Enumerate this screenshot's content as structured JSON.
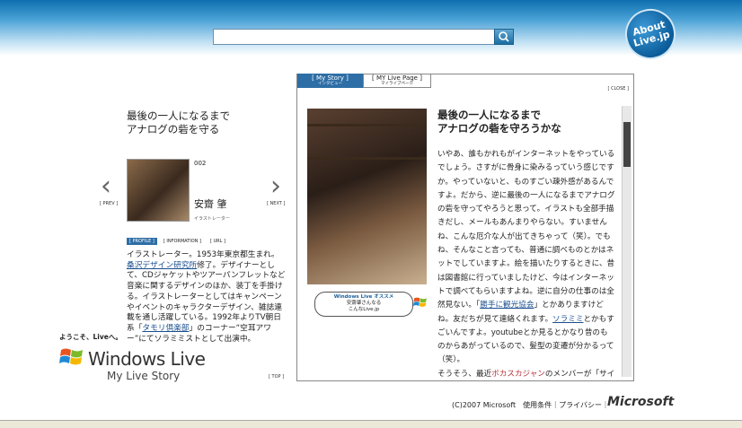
{
  "about_badge": [
    "About",
    "Live.jp"
  ],
  "left_title": [
    "最後の一人になるまで",
    "アナログの砦を守る"
  ],
  "person": {
    "number": "002",
    "name": "安齋 肇",
    "role": "イラストレーター"
  },
  "nav": {
    "prev": "[ PREV ]",
    "next": "[ NEXT ]"
  },
  "left_tabs": [
    "[ PROFILE ]",
    "[ INFORMATION ]",
    "[ URL ]"
  ],
  "bio": {
    "p1": "イラストレーター。1953年東京都生まれ。",
    "link1": "桑沢デザイン研究所",
    "p2": "修了。デザイナーとして、CDジャケットやツアーパンフレットなど音楽に関するデザインのほか、装丁を手掛ける。イラストレーターとしてはキャンペーンやイベントのキャラクターデザイン、雑誌連載を通し活躍している。1992年よりTV朝日系「",
    "link2": "タモリ倶楽部",
    "p3": "」のコーナー“空耳アワー”にてソラミミストとして出演中。"
  },
  "welcome": "ようこそ、Liveへ。",
  "logo": {
    "text": "Windows Live",
    "sub": "My Live Story"
  },
  "top_link": "[ TOP ]",
  "panel_tabs": [
    {
      "label": "[ My Story ]",
      "sub": "インタビュー"
    },
    {
      "label": "[ MY Live Page ]",
      "sub": "マイライブページ"
    }
  ],
  "close": "[ CLOSE ]",
  "bubble": {
    "line1": "Windows Live オススメ",
    "line2": "安齋肇さんなる",
    "line3": "こんなLive.jp"
  },
  "story_title": [
    "最後の一人になるまで",
    "アナログの砦を守ろうかな"
  ],
  "story": {
    "p1": "いやあ、誰もかれもがインターネットをやっているでしょう。さすがに骨身に染みるっていう感じですか。やっていないと、ものすごい疎外感があるんですよ。だから、逆に最後の一人になるまでアナログの砦を守ってやろうと思って。イラストも全部手描きだし、メールもあんまりやらない。すいませんね、こんな厄介な人が出てきちゃって（笑）。でもね、そんなこと言っても、普通に調べものとかはネットでしていますよ。絵を描いたりするときに、昔は図書館に行っていましたけど、今はインターネットで調べてもらいますよね。逆に自分の仕事のは全然見ない。「",
    "link1": "勝手に観光協会",
    "p2": "」とかありますけどね。友だちが見て連絡くれます。",
    "link2": "ソラミミ",
    "p3": "とかもすごいんですよ。youtubeとか見るとかなり昔のものからあがっているので、髪型の変遷が分かるって（笑）。",
    "p4": "そうそう、最近",
    "red": "ボカスカジャン",
    "p5": "のメンバーが「サイ"
  },
  "footer": "(C)2007 Microsoft　使用条件｜プライバシー｜",
  "microsoft": "Microsoft",
  "colors": {
    "accent": "#2e6ea6",
    "link": "#1a4f8f",
    "red": "#b8313a"
  }
}
